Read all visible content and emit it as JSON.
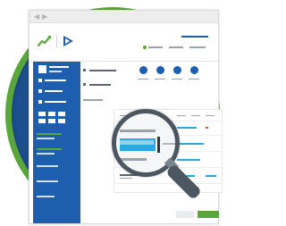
{
  "window": {
    "nav_back": "◀",
    "nav_forward": "▶"
  },
  "app": {
    "logo_primary_color": "#5aa63c",
    "logo_secondary_color": "#1d5fae",
    "accent_color": "#1d5fae",
    "success_color": "#5aa63c"
  },
  "stepper": {
    "steps": 4,
    "active_step": 1
  },
  "icons": [
    "chart-trend-icon",
    "brand-logo-icon",
    "magnifier-icon"
  ],
  "highlight": {
    "bar_color": "#27a9e1"
  }
}
